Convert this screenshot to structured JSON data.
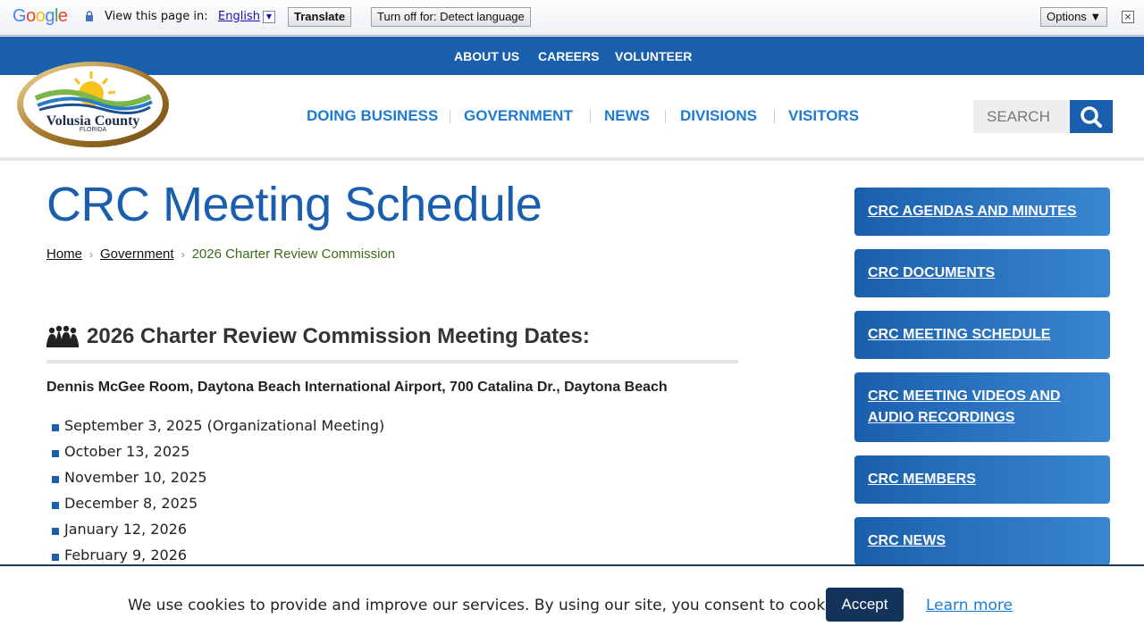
{
  "translate_bar": {
    "logo_text": "Google",
    "view_label": "View this page in:",
    "language": "English",
    "translate_button": "Translate",
    "turn_off_button": "Turn off for: Detect language",
    "options_button": "Options ▼",
    "close_glyph": "×"
  },
  "utility_nav": [
    "ABOUT US",
    "CAREERS",
    "VOLUNTEER"
  ],
  "logo": {
    "name": "Volusia County",
    "state": "FLORIDA"
  },
  "main_nav": [
    "DOING BUSINESS",
    "GOVERNMENT",
    "NEWS",
    "DIVISIONS",
    "VISITORS"
  ],
  "search": {
    "placeholder": "SEARCH"
  },
  "page_title": "CRC Meeting Schedule",
  "breadcrumb": {
    "home": "Home",
    "parent": "Government",
    "current": "2026 Charter Review Commission"
  },
  "section": {
    "title": "2026 Charter Review Commission Meeting Dates:",
    "location": "Dennis McGee Room, Daytona Beach International Airport, 700 Catalina Dr., Daytona Beach",
    "dates": [
      "September 3, 2025 (Organizational Meeting)",
      "October 13, 2025",
      "November 10, 2025",
      "December 8, 2025",
      "January 12, 2026",
      "February 9, 2026"
    ]
  },
  "sidebar": [
    "CRC AGENDAS AND MINUTES",
    "CRC DOCUMENTS",
    "CRC MEETING SCHEDULE",
    "CRC MEETING VIDEOS AND AUDIO RECORDINGS",
    "CRC MEMBERS",
    "CRC NEWS"
  ],
  "cookie": {
    "text": "We use cookies to provide and improve our services. By using our site, you consent to cookies.",
    "accept": "Accept",
    "learn_more": "Learn more"
  },
  "colors": {
    "brand_blue": "#1a5fad",
    "link_blue": "#1d7bd3",
    "breadcrumb_green": "#3a6b1a"
  }
}
